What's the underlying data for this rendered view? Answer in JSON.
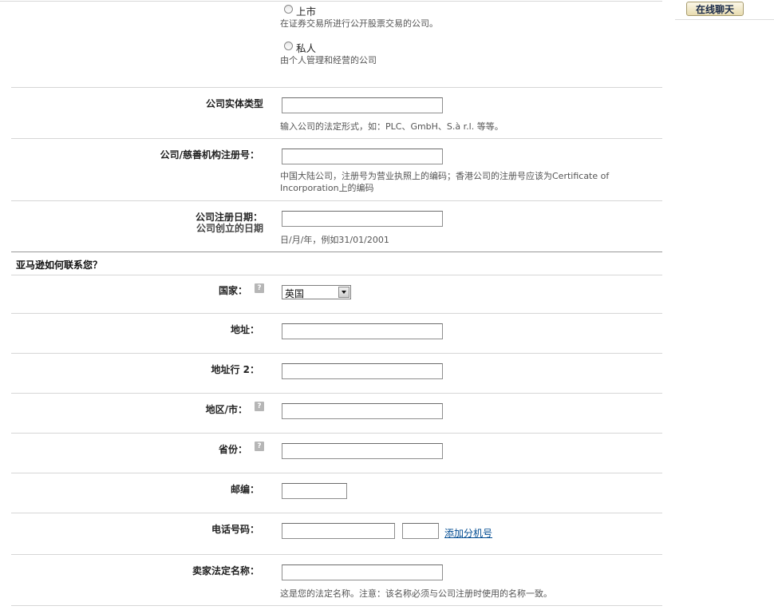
{
  "chat": {
    "label": "在线聊天"
  },
  "company_type": {
    "listed": {
      "label": "上市",
      "help": "在证券交易所进行公开股票交易的公司。"
    },
    "private": {
      "label": "私人",
      "help": "由个人管理和经营的公司"
    }
  },
  "entity_type": {
    "label": "公司实体类型",
    "value": "",
    "help": "输入公司的法定形式，如：PLC、GmbH、S.à r.l. 等等。"
  },
  "reg_number": {
    "label": "公司/慈善机构注册号：",
    "value": "",
    "help": "中国大陆公司，注册号为营业执照上的编码；香港公司的注册号应该为Certificate of Incorporation上的编码"
  },
  "reg_date": {
    "label": "公司注册日期：",
    "sublabel": "公司创立的日期",
    "value": "",
    "help": "日/月/年，例如31/01/2001"
  },
  "contact_section": {
    "title": "亚马逊如何联系您？"
  },
  "country": {
    "label": "国家：",
    "selected": "英国"
  },
  "address": {
    "label": "地址：",
    "value": ""
  },
  "address2": {
    "label": "地址行 2：",
    "value": ""
  },
  "city": {
    "label": "地区/市：",
    "value": ""
  },
  "province": {
    "label": "省份：",
    "value": ""
  },
  "postcode": {
    "label": "邮编：",
    "value": ""
  },
  "phone": {
    "label": "电话号码：",
    "value": "",
    "extension": "",
    "add_ext_link": "添加分机号"
  },
  "legal_name": {
    "label": "卖家法定名称：",
    "value": "",
    "help": "这是您的法定名称。注意：该名称必须与公司注册时使用的名称一致。"
  },
  "help_icon": "help-question-icon"
}
